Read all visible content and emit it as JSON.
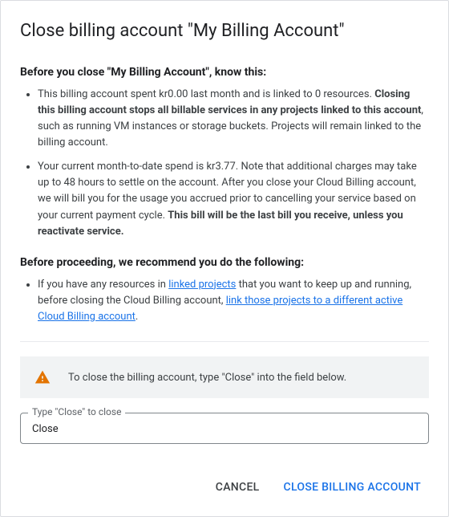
{
  "dialog": {
    "title": "Close billing account \"My Billing Account\"",
    "section1_heading": "Before you close \"My Billing Account\", know this:",
    "bullet1_part1": "This billing account spent kr0.00 last month and is linked to 0 resources. ",
    "bullet1_bold": "Closing this billing account stops all billable services in any projects linked to this account",
    "bullet1_part2": ", such as running VM instances or storage buckets. Projects will remain linked to the billing account.",
    "bullet2_part1": "Your current month-to-date spend is kr3.77. Note that additional charges may take up to 48 hours to settle on the account. After you close your Cloud Billing account, we will bill you for the usage you accrued prior to cancelling your service based on your current payment cycle. ",
    "bullet2_bold": "This bill will be the last bill you receive, unless you reactivate service.",
    "section2_heading": "Before proceeding, we recommend you do the following:",
    "bullet3_part1": "If you have any resources in ",
    "bullet3_link1": "linked projects",
    "bullet3_part2": " that you want to keep up and running, before closing the Cloud Billing account, ",
    "bullet3_link2": "link those projects to a different active Cloud Billing account",
    "bullet3_part3": ".",
    "alert_text": "To close the billing account, type \"Close\" into the field below.",
    "input_label": "Type \"Close\" to close",
    "input_value": "Close",
    "cancel_label": "Cancel",
    "confirm_label": "Close Billing Account"
  }
}
